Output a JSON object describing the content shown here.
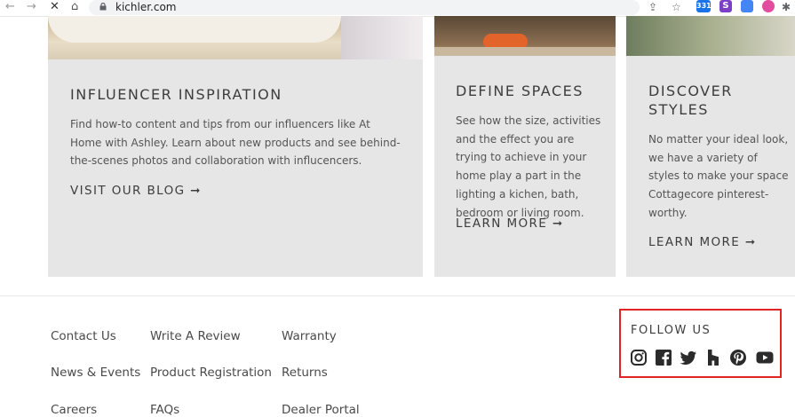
{
  "browser": {
    "url": "kichler.com",
    "extension_badge": "331",
    "extension_s": "S"
  },
  "cards": [
    {
      "title": "INFLUENCER INSPIRATION",
      "body": "Find how-to content and tips from our influencers like At Home with Ashley. Learn about new products and see behind-the-scenes photos and collaboration with influcencers.",
      "cta": "VISIT OUR BLOG ➞"
    },
    {
      "title": "DEFINE SPACES",
      "body": "See how the size, activities and the effect you are trying to achieve in your home play a part in the lighting a kichen, bath, bedroom or living room.",
      "cta": "LEARN MORE ➞"
    },
    {
      "title": "DISCOVER STYLES",
      "body": "No matter your ideal look, we have a variety of styles to make your space Cottagecore pinterest-worthy.",
      "cta": "LEARN MORE ➞"
    }
  ],
  "footer": {
    "col1": [
      "Contact Us",
      "News & Events",
      "Careers"
    ],
    "col2": [
      "Write A Review",
      "Product Registration",
      "FAQs"
    ],
    "col3": [
      "Warranty",
      "Returns",
      "Dealer Portal"
    ]
  },
  "follow": {
    "title": "FOLLOW US",
    "icons": [
      "instagram-icon",
      "facebook-icon",
      "twitter-icon",
      "houzz-icon",
      "pinterest-icon",
      "youtube-icon"
    ]
  },
  "colors": {
    "card_bg": "#e6e6e6",
    "highlight_border": "#e02424",
    "text": "#3d3d3d"
  }
}
